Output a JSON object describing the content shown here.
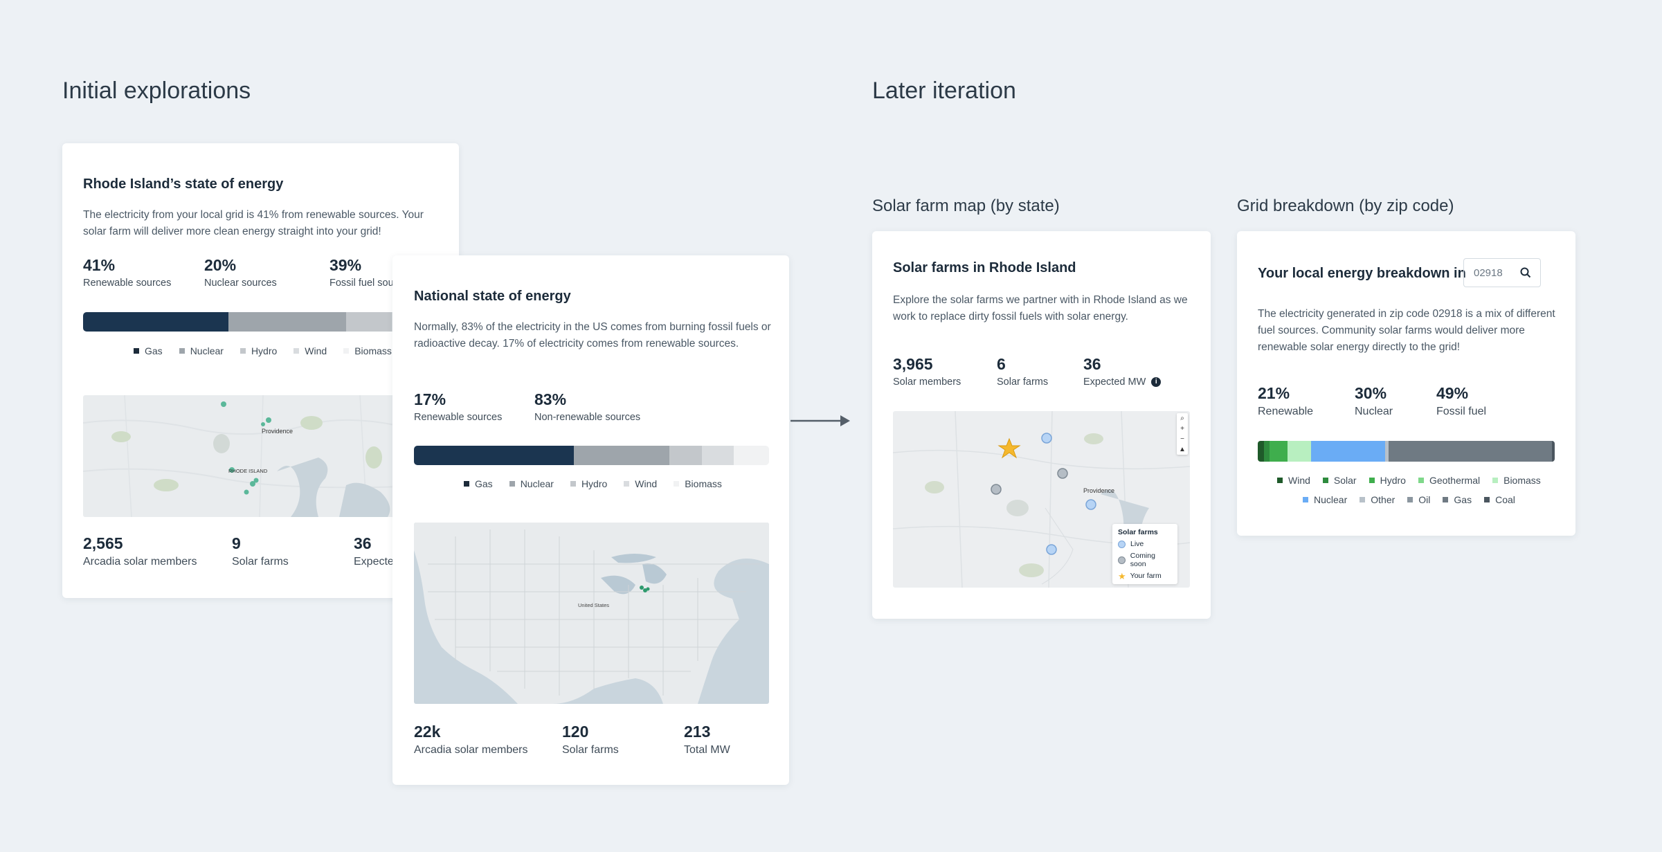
{
  "sections": {
    "initial": "Initial explorations",
    "later": "Later iteration",
    "solar_map": "Solar farm map (by state)",
    "grid": "Grid breakdown (by zip code)"
  },
  "ri_card": {
    "title": "Rhode Island’s state of energy",
    "desc": "The electricity from your local grid is 41% from renewable sources. Your solar farm will deliver more clean energy straight into your grid!",
    "stats": [
      {
        "num": "41%",
        "label": "Renewable sources"
      },
      {
        "num": "20%",
        "label": "Nuclear sources"
      },
      {
        "num": "39%",
        "label": "Fossil fuel sour"
      }
    ],
    "bar": [
      0.41,
      0.33,
      0.13,
      0.08,
      0.05
    ],
    "legend": [
      "Gas",
      "Nuclear",
      "Hydro",
      "Wind",
      "Biomass"
    ],
    "map_labels": {
      "city": "Providence",
      "state": "RHODE ISLAND"
    },
    "bottom": [
      {
        "num": "2,565",
        "label": "Arcadia solar members"
      },
      {
        "num": "9",
        "label": "Solar farms"
      },
      {
        "num": "36",
        "label": "Expecte"
      }
    ]
  },
  "national_card": {
    "title": "National state of energy",
    "desc": "Normally, 83% of the electricity in the US comes from burning fossil fuels or radioactive decay. 17% of electricity comes from renewable sources.",
    "stats": [
      {
        "num": "17%",
        "label": "Renewable sources"
      },
      {
        "num": "83%",
        "label": "Non-renewable sources"
      }
    ],
    "bar": [
      0.45,
      0.27,
      0.09,
      0.09,
      0.1
    ],
    "legend": [
      "Gas",
      "Nuclear",
      "Hydro",
      "Wind",
      "Biomass"
    ],
    "map_label": "United States",
    "bottom": [
      {
        "num": "22k",
        "label": "Arcadia solar members"
      },
      {
        "num": "120",
        "label": "Solar farms"
      },
      {
        "num": "213",
        "label": "Total MW"
      }
    ]
  },
  "solar_card": {
    "title": "Solar farms in Rhode Island",
    "desc": "Explore the solar farms we partner with in Rhode Island as we work to replace dirty fossil fuels with solar energy.",
    "stats": [
      {
        "num": "3,965",
        "label": "Solar members"
      },
      {
        "num": "6",
        "label": "Solar farms"
      },
      {
        "num": "36",
        "label": "Expected MW"
      }
    ],
    "map_city": "Providence",
    "map_legend": {
      "title": "Solar farms",
      "live": "Live",
      "coming": "Coming soon",
      "yours": "Your farm"
    },
    "zoom": [
      "+",
      "−",
      "▲"
    ]
  },
  "grid_card": {
    "title": "Your local energy breakdown in",
    "zip": "02918",
    "desc": "The electricity generated in zip code 02918 is a mix of different fuel sources. Community solar farms would deliver more renewable solar energy directly to the grid!",
    "stats": [
      {
        "num": "21%",
        "label": "Renewable"
      },
      {
        "num": "30%",
        "label": "Nuclear"
      },
      {
        "num": "49%",
        "label": "Fossil fuel"
      }
    ],
    "bar": [
      {
        "name": "Wind",
        "value": 0.02,
        "color": "#1f5a2a"
      },
      {
        "name": "Solar",
        "value": 0.02,
        "color": "#2e8b3e"
      },
      {
        "name": "Hydro",
        "value": 0.06,
        "color": "#3fae4d"
      },
      {
        "name": "Geothermal",
        "value": 0.0,
        "color": "#7fd88a"
      },
      {
        "name": "Biomass",
        "value": 0.08,
        "color": "#b8efc0"
      },
      {
        "name": "Nuclear",
        "value": 0.25,
        "color": "#6aacf5"
      },
      {
        "name": "Other",
        "value": 0.01,
        "color": "#b8c1c9"
      },
      {
        "name": "Oil",
        "value": 0.0,
        "color": "#8b969f"
      },
      {
        "name": "Gas",
        "value": 0.55,
        "color": "#6f7a83"
      },
      {
        "name": "Coal",
        "value": 0.01,
        "color": "#4b565f"
      }
    ],
    "legend_row1": [
      "Wind",
      "Solar",
      "Hydro",
      "Geothermal",
      "Biomass"
    ],
    "legend_row2": [
      "Nuclear",
      "Other",
      "Oil",
      "Gas",
      "Coal"
    ]
  },
  "colors": {
    "navy": "#1b3550",
    "gray1": "#9ea5ab",
    "gray2": "#c3c7cb",
    "gray3": "#d9dcdf",
    "gray4": "#f1f2f3"
  }
}
